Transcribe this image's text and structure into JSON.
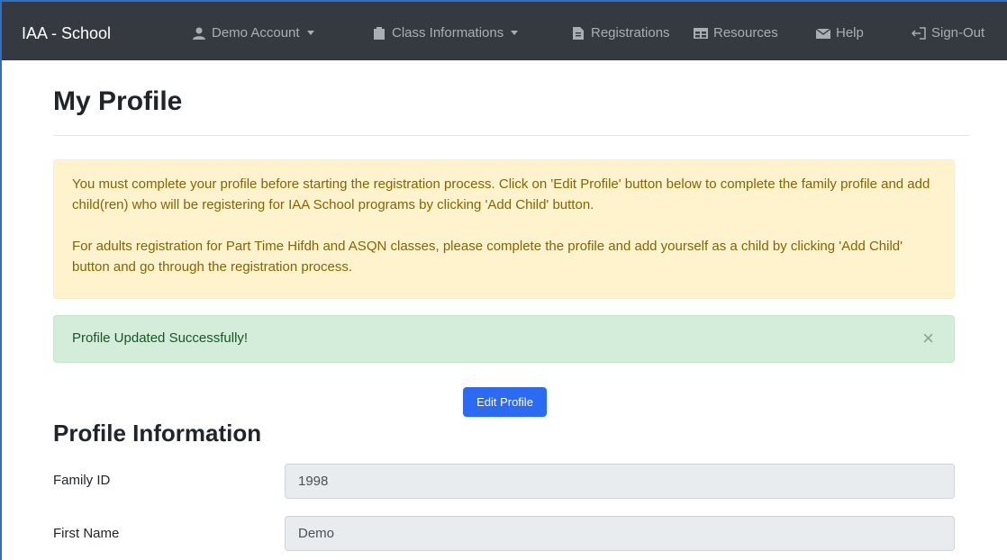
{
  "navbar": {
    "brand": "IAA - School",
    "items": [
      {
        "label": "Demo Account",
        "icon": "user-icon",
        "dropdown": true
      },
      {
        "label": "Class Informations",
        "icon": "clipboard-icon",
        "dropdown": true
      },
      {
        "label": "Registrations",
        "icon": "document-icon",
        "dropdown": false
      },
      {
        "label": "Resources",
        "icon": "table-icon",
        "dropdown": false
      },
      {
        "label": "Help",
        "icon": "envelope-icon",
        "dropdown": false
      },
      {
        "label": "Sign-Out",
        "icon": "sign-out-icon",
        "dropdown": false
      }
    ]
  },
  "page": {
    "title": "My Profile"
  },
  "alerts": {
    "warning": {
      "paragraph1": "You must complete your profile before starting the registration process. Click on 'Edit Profile' button below to complete the family profile and add child(ren) who will be registering for IAA School programs by clicking 'Add Child' button.",
      "paragraph2": "For adults registration for Part Time Hifdh and ASQN classes, please complete the profile and add yourself as a child by clicking 'Add Child' button and go through the registration process."
    },
    "success": {
      "message": "Profile Updated Successfully!",
      "close_symbol": "×"
    }
  },
  "actions": {
    "edit_profile": "Edit Profile"
  },
  "profile": {
    "section_title": "Profile Information",
    "fields": [
      {
        "label": "Family ID",
        "value": "1998"
      },
      {
        "label": "First Name",
        "value": "Demo"
      }
    ]
  },
  "colors": {
    "navbar_bg": "#343a40",
    "primary": "#2b6bf3",
    "warning_bg": "#fff3cd",
    "warning_text": "#856404",
    "success_bg": "#d4edda",
    "success_text": "#155724"
  }
}
